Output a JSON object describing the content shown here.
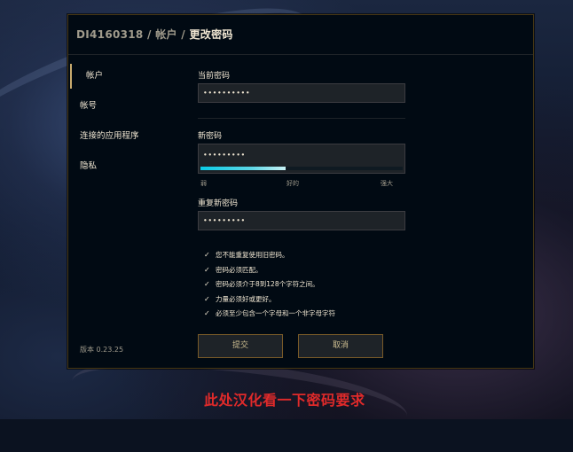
{
  "breadcrumb": {
    "account_id": "DI4160318",
    "sep1": " / ",
    "section": "帐户",
    "sep2": " / ",
    "page": "更改密码"
  },
  "sidebar": {
    "items": [
      {
        "label": "帐户",
        "active": true
      },
      {
        "label": "帐号"
      },
      {
        "label": "连接的应用程序"
      },
      {
        "label": "隐私"
      }
    ],
    "version": "版本 0.23.25"
  },
  "form": {
    "current_password": {
      "label": "当前密码",
      "value": "••••••••••"
    },
    "new_password": {
      "label": "新密码",
      "value": "•••••••••",
      "strength": 0.42
    },
    "strength_labels": {
      "weak": "弱",
      "good": "好的",
      "strong": "强大"
    },
    "confirm_password": {
      "label": "重复新密码",
      "value": "•••••••••"
    },
    "requirements": [
      "您不能重复使用旧密码。",
      "密码必须匹配。",
      "密码必须介于8到128个字符之间。",
      "力量必须好或更好。",
      "必须至少包含一个字母和一个非字母字符"
    ],
    "check_glyph": "✓",
    "submit_label": "提交",
    "cancel_label": "取消"
  },
  "annotation": "此处汉化看一下密码要求",
  "colors": {
    "gold_border": "#785a28",
    "gold_accent": "#c8aa6e",
    "text": "#f0e6d2",
    "muted": "#a09b8c",
    "strength": "#0acbe6",
    "annotation": "#e02a2a"
  }
}
